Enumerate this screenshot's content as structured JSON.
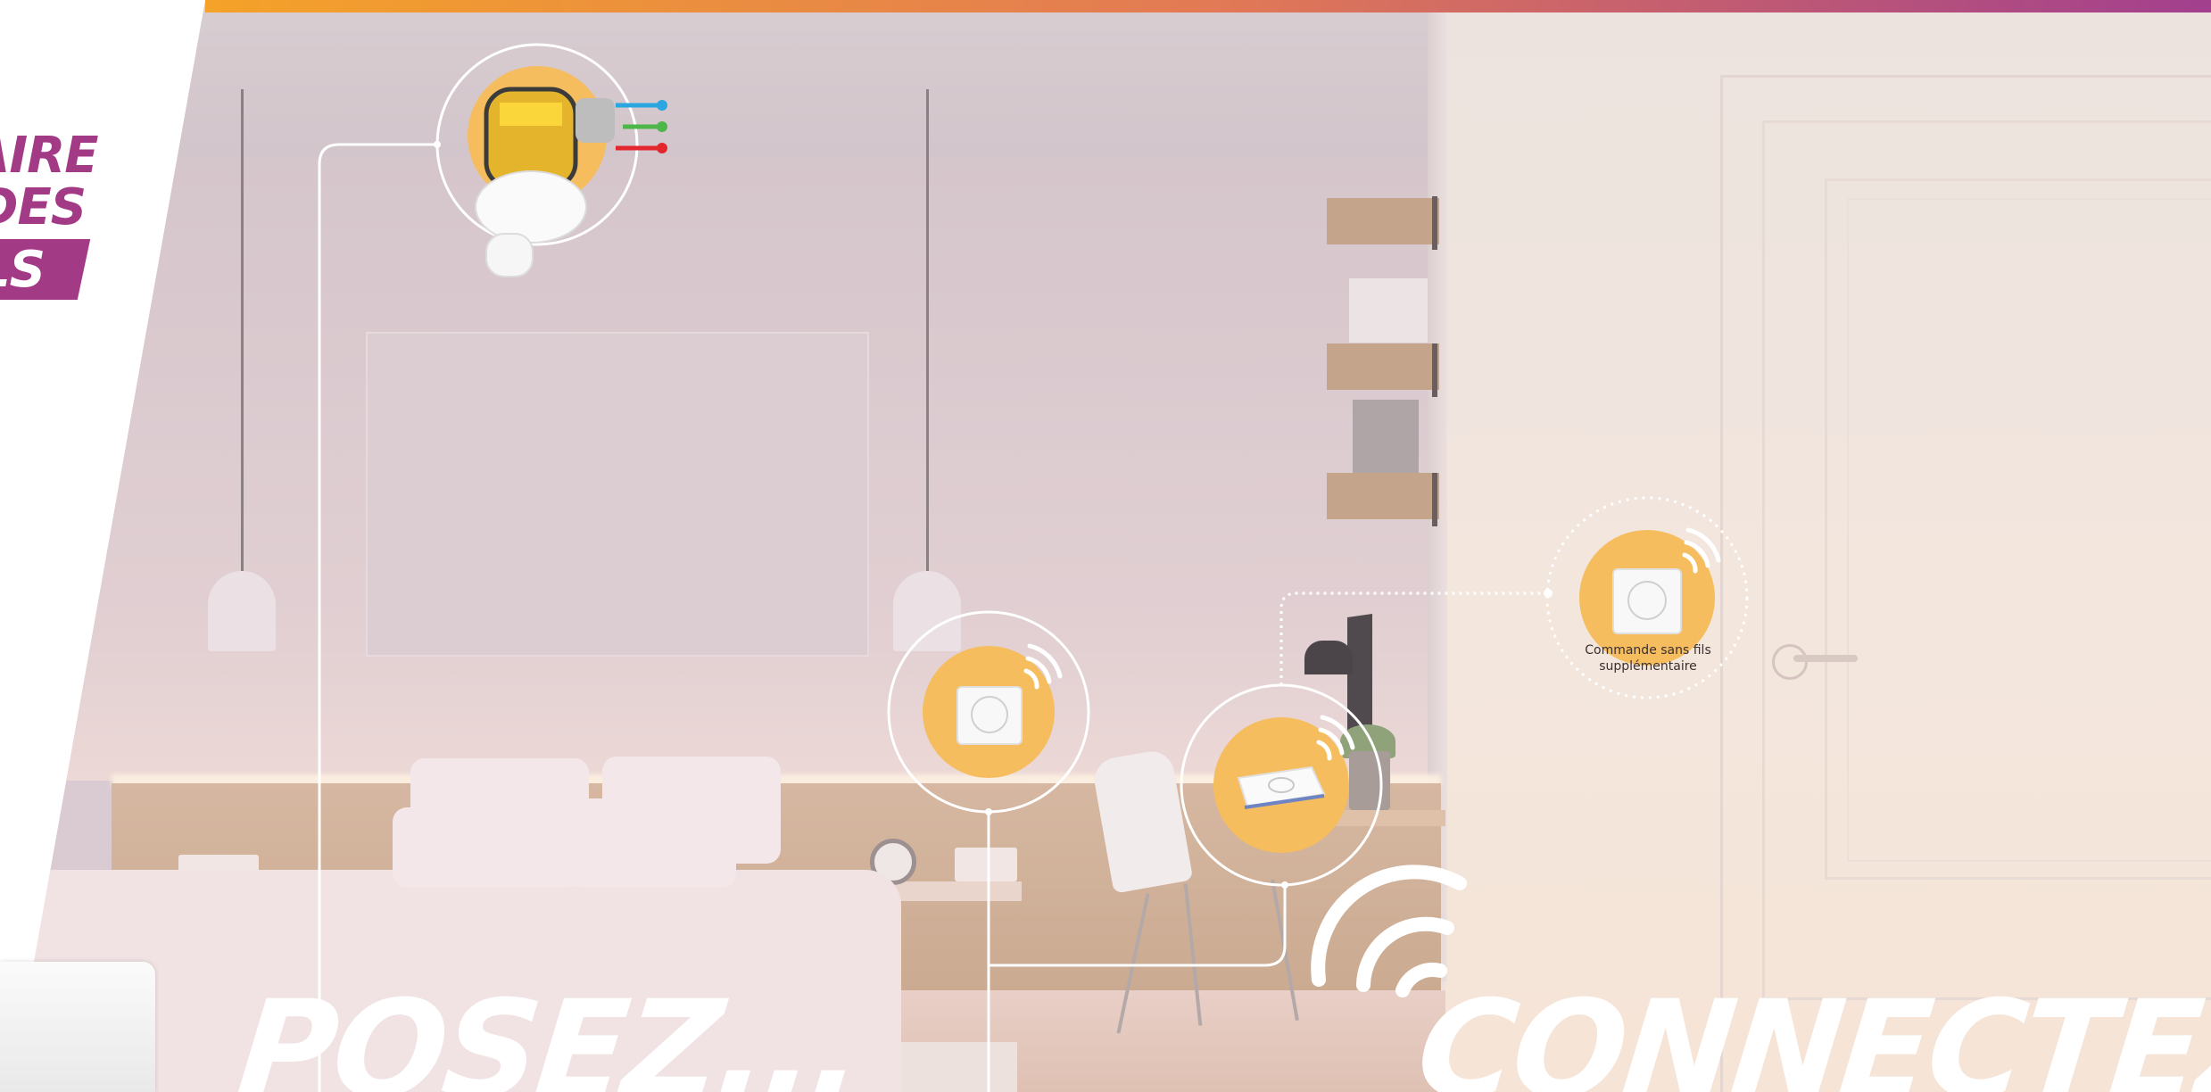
{
  "banner": {
    "line1": "AIRE",
    "line2": "DES",
    "line3": "LS"
  },
  "headline": {
    "left": "POSEZ...",
    "right": "CONNECTEZ !"
  },
  "devices": {
    "extra_switch_caption_line1": "Commande sans fils",
    "extra_switch_caption_line2": "supplémentaire"
  },
  "colors": {
    "accent_purple": "#a33a86",
    "accent_orange": "#f4a229",
    "device_circle": "#f5bd5e",
    "wire_blue": "#2aa6e0",
    "wire_green": "#4cb748",
    "wire_red": "#e3262d"
  },
  "icons": {
    "lamp_module": "light-socket-module-icon",
    "switch": "wireless-switch-icon",
    "dimmer": "wireless-dimmer-icon",
    "signal": "wifi-signal-icon"
  }
}
